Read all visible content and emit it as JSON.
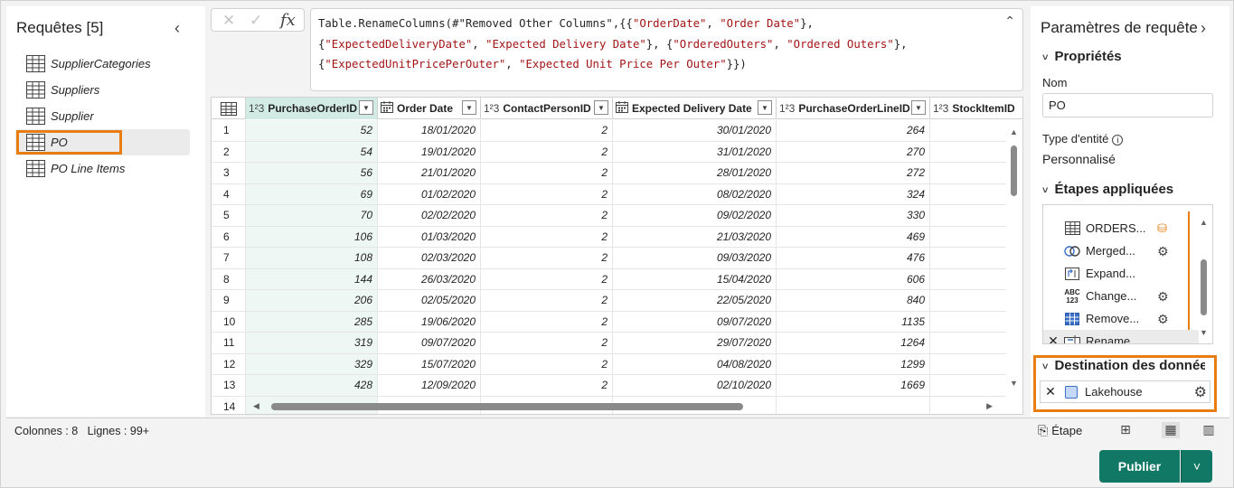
{
  "queries_pane": {
    "title": "Requêtes [5]",
    "items": [
      {
        "label": "SupplierCategories"
      },
      {
        "label": "Suppliers"
      },
      {
        "label": "Supplier"
      },
      {
        "label": "PO",
        "selected": true
      },
      {
        "label": "PO Line Items"
      }
    ]
  },
  "formula_bar": {
    "fx": "fx",
    "lines": [
      [
        "Table.RenameColumns(#\"Removed Other Columns\",{{",
        "\"OrderDate\"",
        ", ",
        "\"Order Date\"",
        "},"
      ],
      [
        "{",
        "\"ExpectedDeliveryDate\"",
        ", ",
        "\"Expected Delivery Date\"",
        "}, {",
        "\"OrderedOuters\"",
        ", ",
        "\"Ordered Outers\"",
        "},"
      ],
      [
        "{",
        "\"ExpectedUnitPricePerOuter\"",
        ", ",
        "\"Expected Unit Price Per Outer\"",
        "}})"
      ]
    ]
  },
  "grid": {
    "columns": [
      {
        "type": "1²3",
        "name": "PurchaseOrderID",
        "selected": true
      },
      {
        "type": "cal",
        "name": "Order Date"
      },
      {
        "type": "1²3",
        "name": "ContactPersonID"
      },
      {
        "type": "cal",
        "name": "Expected Delivery Date"
      },
      {
        "type": "1²3",
        "name": "PurchaseOrderLineID"
      },
      {
        "type": "1²3",
        "name": "StockItemID"
      }
    ],
    "rows": [
      {
        "n": "1",
        "v": [
          "52",
          "18/01/2020",
          "2",
          "30/01/2020",
          "264",
          ""
        ]
      },
      {
        "n": "2",
        "v": [
          "54",
          "19/01/2020",
          "2",
          "31/01/2020",
          "270",
          ""
        ]
      },
      {
        "n": "3",
        "v": [
          "56",
          "21/01/2020",
          "2",
          "28/01/2020",
          "272",
          ""
        ]
      },
      {
        "n": "4",
        "v": [
          "69",
          "01/02/2020",
          "2",
          "08/02/2020",
          "324",
          ""
        ]
      },
      {
        "n": "5",
        "v": [
          "70",
          "02/02/2020",
          "2",
          "09/02/2020",
          "330",
          ""
        ]
      },
      {
        "n": "6",
        "v": [
          "106",
          "01/03/2020",
          "2",
          "21/03/2020",
          "469",
          ""
        ]
      },
      {
        "n": "7",
        "v": [
          "108",
          "02/03/2020",
          "2",
          "09/03/2020",
          "476",
          ""
        ]
      },
      {
        "n": "8",
        "v": [
          "144",
          "26/03/2020",
          "2",
          "15/04/2020",
          "606",
          ""
        ]
      },
      {
        "n": "9",
        "v": [
          "206",
          "02/05/2020",
          "2",
          "22/05/2020",
          "840",
          ""
        ]
      },
      {
        "n": "10",
        "v": [
          "285",
          "19/06/2020",
          "2",
          "09/07/2020",
          "1135",
          ""
        ]
      },
      {
        "n": "11",
        "v": [
          "319",
          "09/07/2020",
          "2",
          "29/07/2020",
          "1264",
          ""
        ]
      },
      {
        "n": "12",
        "v": [
          "329",
          "15/07/2020",
          "2",
          "04/08/2020",
          "1299",
          ""
        ]
      },
      {
        "n": "13",
        "v": [
          "428",
          "12/09/2020",
          "2",
          "02/10/2020",
          "1669",
          ""
        ]
      },
      {
        "n": "14",
        "v": [
          "",
          "",
          "",
          "",
          "",
          ""
        ]
      }
    ]
  },
  "settings": {
    "title": "Paramètres de requête",
    "properties_label": "Propriétés",
    "name_label": "Nom",
    "name_value": "PO",
    "entity_type_label": "Type d'entité",
    "entity_type_value": "Personnalisé",
    "applied_steps_label": "Étapes appliquées",
    "steps": [
      {
        "label": "ORDERS...",
        "icon": "table-icon"
      },
      {
        "label": "Merged...",
        "icon": "merge-icon",
        "gear": true
      },
      {
        "label": "Expand...",
        "icon": "expand-icon"
      },
      {
        "label": "Change...",
        "icon": "type-change-icon",
        "gear": true
      },
      {
        "label": "Remove...",
        "icon": "remove-columns-icon",
        "gear": true
      },
      {
        "label": "Rename...",
        "icon": "rename-icon",
        "active": true
      }
    ],
    "destination_label": "Destination des données",
    "destination_value": "Lakehouse"
  },
  "status_bar": {
    "columns_text": "Colonnes : 8",
    "rows_text": "Lignes : 99+",
    "step_label": "Étape"
  },
  "publish": {
    "label": "Publier"
  },
  "colors": {
    "accent": "#117865",
    "highlight": "#e87e11",
    "selected_header": "#d2ebe4"
  }
}
